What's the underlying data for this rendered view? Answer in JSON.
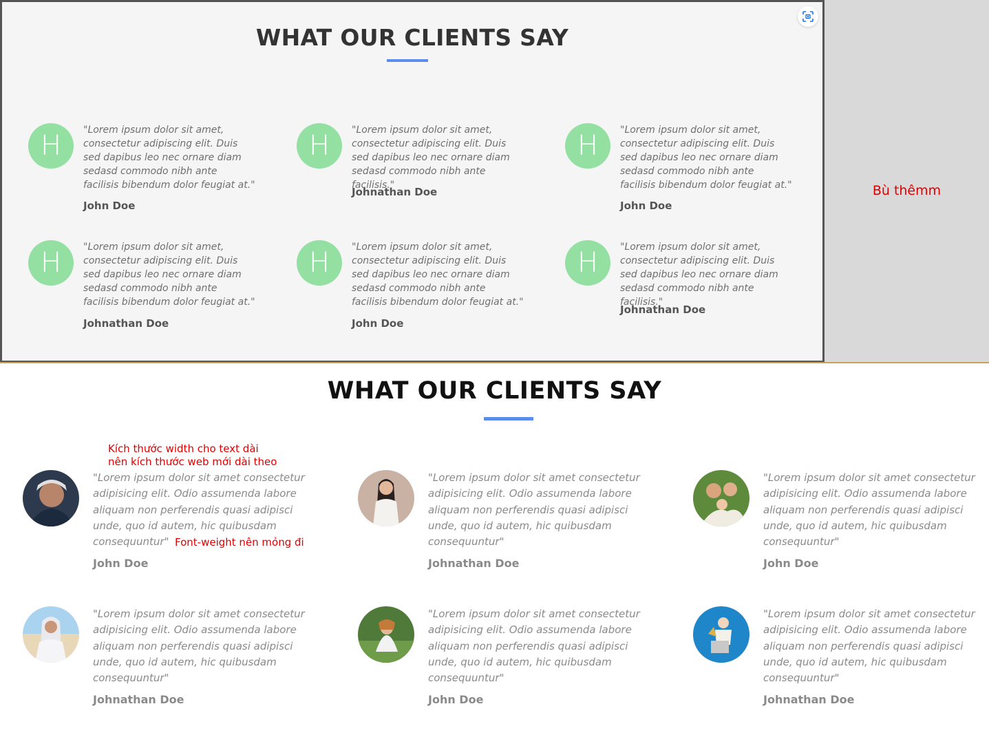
{
  "top": {
    "title": "WHAT OUR CLIENTS SAY",
    "side_note": "Bù thêmm",
    "avatar_letter": "H",
    "cards": [
      {
        "quote": "\"Lorem ipsum dolor sit amet, consectetur adipiscing elit. Duis sed dapibus leo nec ornare diam sedasd commodo nibh ante facilisis bibendum dolor feugiat at.\"",
        "name": "John Doe"
      },
      {
        "quote": "\"Lorem ipsum dolor sit amet, consectetur adipiscing elit. Duis sed dapibus leo nec ornare diam sedasd commodo nibh ante facilisis.\"",
        "name": "Johnathan Doe"
      },
      {
        "quote": "\"Lorem ipsum dolor sit amet, consectetur adipiscing elit. Duis sed dapibus leo nec ornare diam sedasd commodo nibh ante facilisis bibendum dolor feugiat at.\"",
        "name": "John Doe"
      },
      {
        "quote": "\"Lorem ipsum dolor sit amet, consectetur adipiscing elit. Duis sed dapibus leo nec ornare diam sedasd commodo nibh ante facilisis bibendum dolor feugiat at.\"",
        "name": "Johnathan Doe"
      },
      {
        "quote": "\"Lorem ipsum dolor sit amet, consectetur adipiscing elit. Duis sed dapibus leo nec ornare diam sedasd commodo nibh ante facilisis bibendum dolor feugiat at.\"",
        "name": "John Doe"
      },
      {
        "quote": "\"Lorem ipsum dolor sit amet, consectetur adipiscing elit. Duis sed dapibus leo nec ornare diam sedasd commodo nibh ante facilisis.\"",
        "name": "Johnathan Doe"
      }
    ]
  },
  "bottom": {
    "title": "WHAT OUR CLIENTS SAY",
    "note_width_line1": "Kích thước width cho text dài",
    "note_width_line2": "nên kích thước web mới dài theo",
    "note_weight": "Font-weight nên mỏng đi",
    "cards": [
      {
        "quote": "\"Lorem ipsum dolor sit amet consectetur adipisicing elit. Odio assumenda labore aliquam non perferendis quasi adipisci unde, quo id autem, hic quibusdam consequuntur\"",
        "name": "John Doe"
      },
      {
        "quote": "\"Lorem ipsum dolor sit amet consectetur adipisicing elit. Odio assumenda labore aliquam non perferendis quasi adipisci unde, quo id autem, hic quibusdam consequuntur\"",
        "name": "Johnathan Doe"
      },
      {
        "quote": "\"Lorem ipsum dolor sit amet consectetur adipisicing elit. Odio assumenda labore aliquam non perferendis quasi adipisci unde, quo id autem, hic quibusdam consequuntur\"",
        "name": "John Doe"
      },
      {
        "quote": "\"Lorem ipsum dolor sit amet consectetur adipisicing elit. Odio assumenda labore aliquam non perferendis quasi adipisci unde, quo id autem, hic quibusdam consequuntur\"",
        "name": "Johnathan Doe"
      },
      {
        "quote": "\"Lorem ipsum dolor sit amet consectetur adipisicing elit. Odio assumenda labore aliquam non perferendis quasi adipisci unde, quo id autem, hic quibusdam consequuntur\"",
        "name": "John Doe"
      },
      {
        "quote": "\"Lorem ipsum dolor sit amet consectetur adipisicing elit. Odio assumenda labore aliquam non perferendis quasi adipisci unde, quo id autem, hic quibusdam consequuntur\"",
        "name": "Johnathan Doe"
      }
    ]
  },
  "colors": {
    "accent": "#5b8dee",
    "avatar_green": "#94e0a3",
    "annotation_red": "#e00000"
  },
  "icons": {
    "scan": "scan-icon"
  }
}
